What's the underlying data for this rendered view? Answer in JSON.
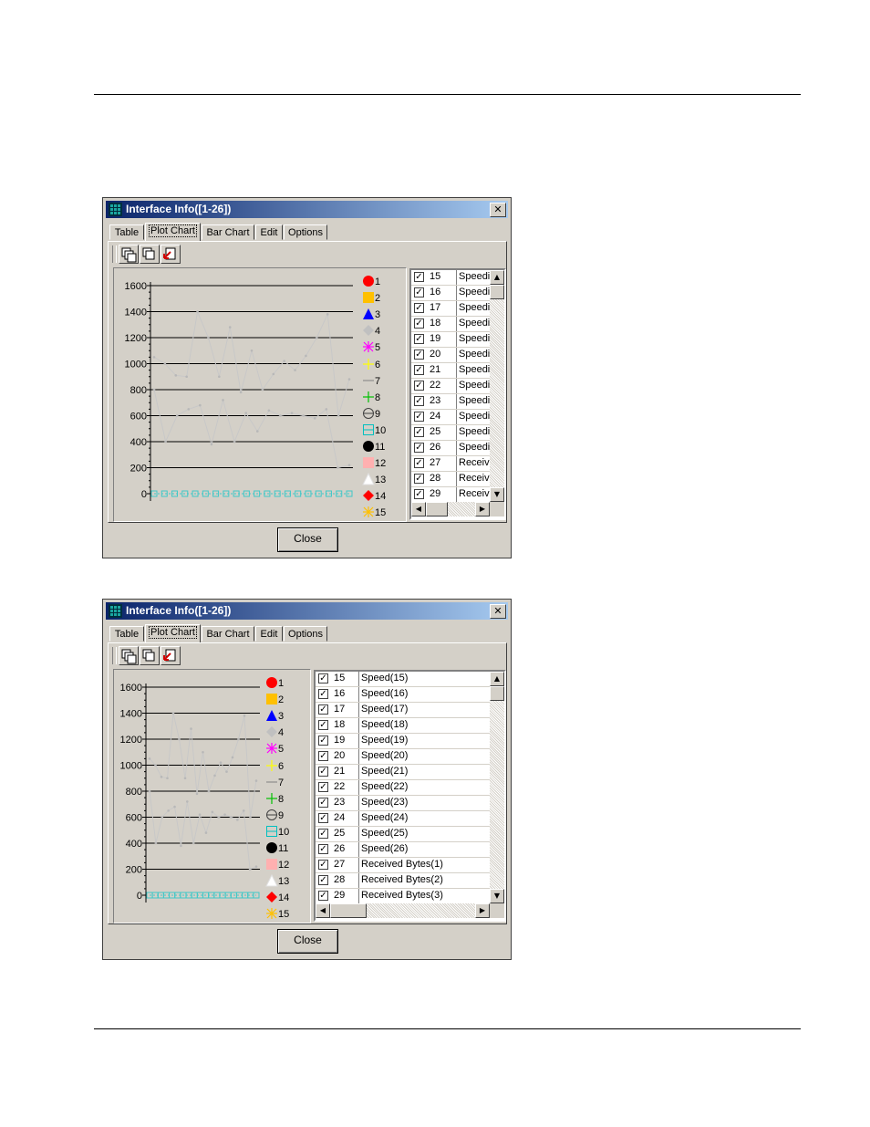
{
  "windows": [
    {
      "title": "Interface Info([1-26])",
      "close_glyph": "✕",
      "tabs": [
        "Table",
        "Plot Chart",
        "Bar Chart",
        "Edit",
        "Options"
      ],
      "active_tab": "Plot Chart",
      "toolbar_icons": [
        "stack-all-icon",
        "stack-icon",
        "export-icon"
      ],
      "legend": [
        "1",
        "2",
        "3",
        "4",
        "5",
        "6",
        "7",
        "8",
        "9",
        "10",
        "11",
        "12",
        "13",
        "14",
        "15"
      ],
      "rows": [
        {
          "checked": true,
          "num": "15",
          "name": "Speedi"
        },
        {
          "checked": true,
          "num": "16",
          "name": "Speedi"
        },
        {
          "checked": true,
          "num": "17",
          "name": "Speedi"
        },
        {
          "checked": true,
          "num": "18",
          "name": "Speedi"
        },
        {
          "checked": true,
          "num": "19",
          "name": "Speedi"
        },
        {
          "checked": true,
          "num": "20",
          "name": "Speedi"
        },
        {
          "checked": true,
          "num": "21",
          "name": "Speedi"
        },
        {
          "checked": true,
          "num": "22",
          "name": "Speedi"
        },
        {
          "checked": true,
          "num": "23",
          "name": "Speedi"
        },
        {
          "checked": true,
          "num": "24",
          "name": "Speedi"
        },
        {
          "checked": true,
          "num": "25",
          "name": "Speedi"
        },
        {
          "checked": true,
          "num": "26",
          "name": "Speedi"
        },
        {
          "checked": true,
          "num": "27",
          "name": "Receiv"
        },
        {
          "checked": true,
          "num": "28",
          "name": "Receiv"
        },
        {
          "checked": true,
          "num": "29",
          "name": "Receiv"
        }
      ],
      "close_label": "Close"
    },
    {
      "title": "Interface Info([1-26])",
      "close_glyph": "✕",
      "tabs": [
        "Table",
        "Plot Chart",
        "Bar Chart",
        "Edit",
        "Options"
      ],
      "active_tab": "Plot Chart",
      "toolbar_icons": [
        "stack-all-icon",
        "stack-icon",
        "export-icon"
      ],
      "legend": [
        "1",
        "2",
        "3",
        "4",
        "5",
        "6",
        "7",
        "8",
        "9",
        "10",
        "11",
        "12",
        "13",
        "14",
        "15"
      ],
      "rows": [
        {
          "checked": true,
          "num": "15",
          "name": "Speed(15)"
        },
        {
          "checked": true,
          "num": "16",
          "name": "Speed(16)"
        },
        {
          "checked": true,
          "num": "17",
          "name": "Speed(17)"
        },
        {
          "checked": true,
          "num": "18",
          "name": "Speed(18)"
        },
        {
          "checked": true,
          "num": "19",
          "name": "Speed(19)"
        },
        {
          "checked": true,
          "num": "20",
          "name": "Speed(20)"
        },
        {
          "checked": true,
          "num": "21",
          "name": "Speed(21)"
        },
        {
          "checked": true,
          "num": "22",
          "name": "Speed(22)"
        },
        {
          "checked": true,
          "num": "23",
          "name": "Speed(23)"
        },
        {
          "checked": true,
          "num": "24",
          "name": "Speed(24)"
        },
        {
          "checked": true,
          "num": "25",
          "name": "Speed(25)"
        },
        {
          "checked": true,
          "num": "26",
          "name": "Speed(26)"
        },
        {
          "checked": true,
          "num": "27",
          "name": "Received Bytes(1)"
        },
        {
          "checked": true,
          "num": "28",
          "name": "Received Bytes(2)"
        },
        {
          "checked": true,
          "num": "29",
          "name": "Received Bytes(3)"
        }
      ],
      "close_label": "Close"
    }
  ],
  "chart_data": {
    "type": "line",
    "ylim": [
      0,
      1600
    ],
    "yticks": [
      "1600",
      "1400",
      "1200",
      "1000",
      "800",
      "600",
      "400",
      "200",
      "0"
    ],
    "grid": true,
    "series": [
      {
        "values": [
          1050,
          1000,
          910,
          900,
          1400,
          1200,
          900,
          1280,
          780,
          1100,
          800,
          920,
          1020,
          950,
          1060,
          1200,
          1380,
          600,
          880
        ]
      },
      {
        "values": [
          800,
          400,
          600,
          650,
          680,
          380,
          720,
          400,
          620,
          480,
          640,
          600,
          620,
          600,
          580,
          650,
          200,
          220
        ]
      },
      {
        "values": [
          0,
          0,
          0,
          0,
          0,
          0,
          0,
          0,
          0,
          0,
          0,
          0,
          0,
          0,
          0,
          0,
          0,
          0,
          0,
          0
        ]
      }
    ]
  }
}
